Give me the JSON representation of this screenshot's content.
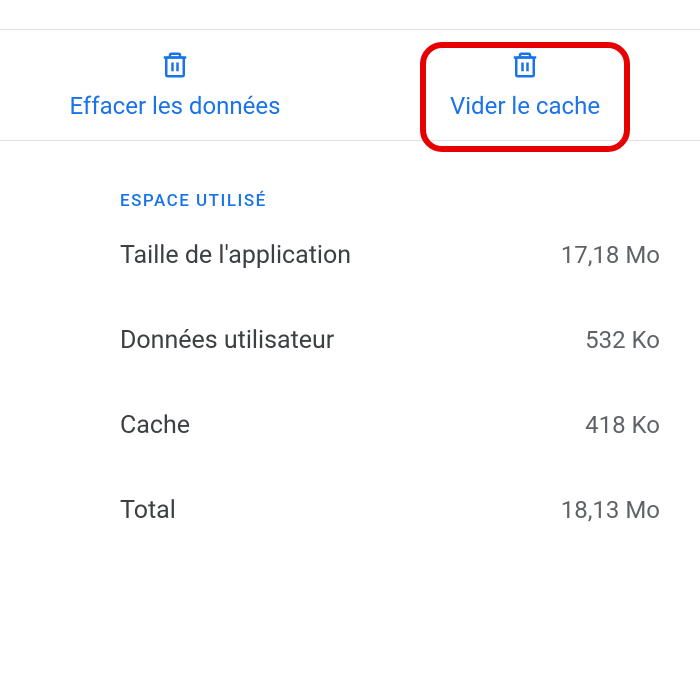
{
  "actions": {
    "clear_data": "Effacer les données",
    "clear_cache": "Vider le cache"
  },
  "storage": {
    "header": "ESPACE UTILISÉ",
    "rows": [
      {
        "label": "Taille de l'application",
        "value": "17,18 Mo"
      },
      {
        "label": "Données utilisateur",
        "value": "532 Ko"
      },
      {
        "label": "Cache",
        "value": "418 Ko"
      },
      {
        "label": "Total",
        "value": "18,13 Mo"
      }
    ]
  }
}
